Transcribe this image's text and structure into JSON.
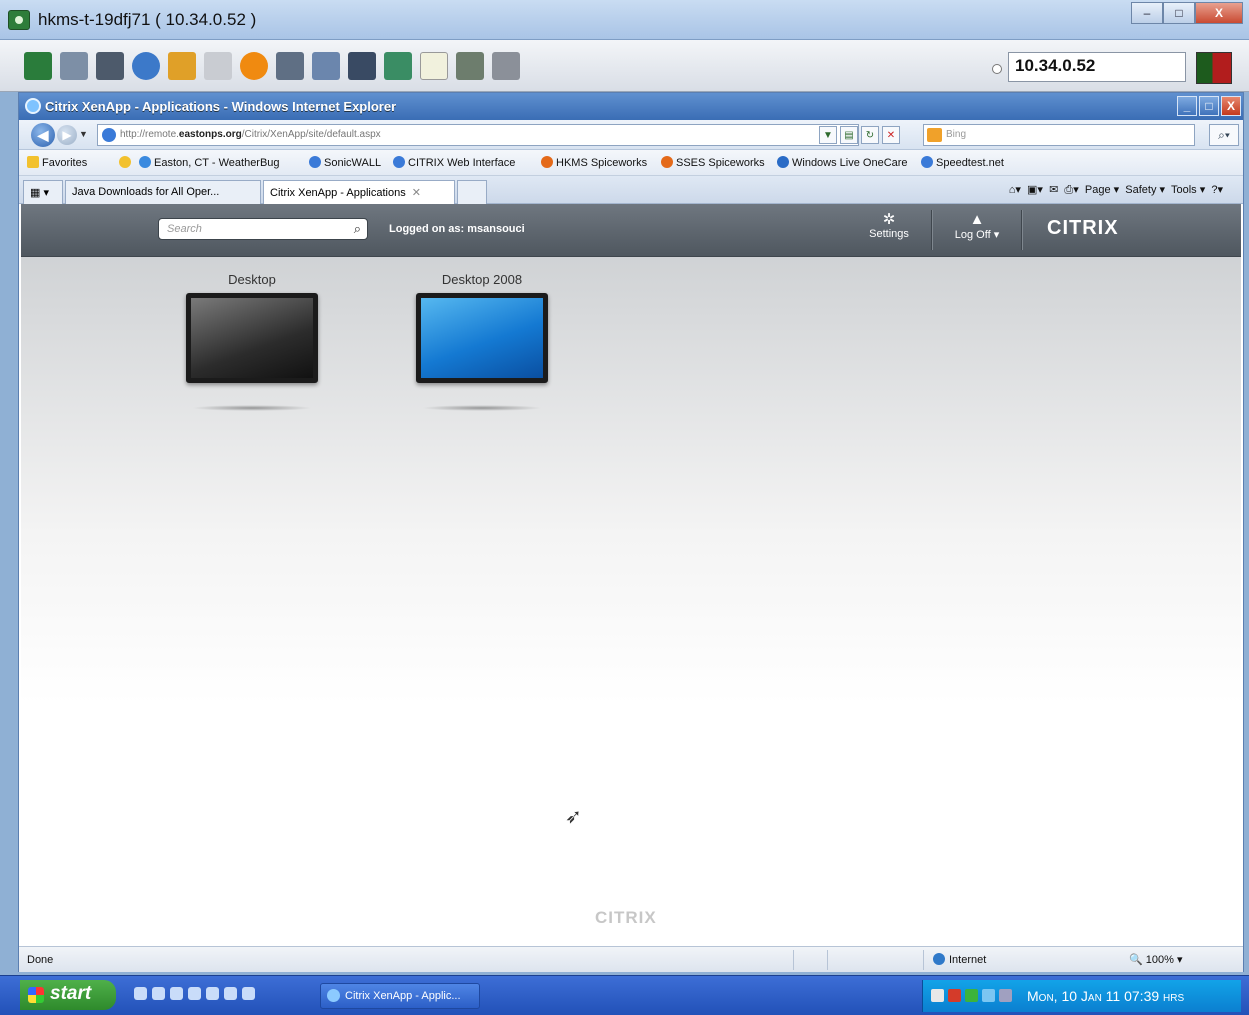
{
  "outer_window": {
    "title": "hkms-t-19dfj71 ( 10.34.0.52 )",
    "controls": {
      "minimize": "–",
      "maximize": "□",
      "close": "X"
    }
  },
  "remote_toolbar": {
    "address": "10.34.0.52",
    "tool_icons": [
      "monitor-icon",
      "tree-icon",
      "tools-icon",
      "refresh-icon",
      "paint-icon",
      "printer-icon",
      "alert-icon",
      "network-icon",
      "fullscreen-icon",
      "display-icon",
      "transfer-icon",
      "file-icon",
      "screenshot-icon",
      "window-icon"
    ],
    "colors": {
      "flag_left": "#1d5b1d",
      "flag_right": "#b21d1d"
    }
  },
  "ie": {
    "title": "Citrix XenApp - Applications - Windows Internet Explorer",
    "controls": {
      "minimize": "_",
      "maximize": "□",
      "close": "X"
    },
    "address_prefix": "http://remote.",
    "address_domain": "eastonps.org",
    "address_path": "/Citrix/XenApp/site/default.aspx",
    "search_placeholder": "Bing",
    "favorites_label": "Favorites",
    "favorites": [
      "Easton, CT - WeatherBug",
      "SonicWALL",
      "CITRIX Web Interface",
      "HKMS Spiceworks",
      "SSES Spiceworks",
      "Windows Live OneCare",
      "Speedtest.net"
    ],
    "tabs": [
      {
        "label": "Java Downloads for All Oper..."
      },
      {
        "label": "Citrix XenApp - Applications",
        "close": "✕"
      }
    ],
    "command_bar": {
      "page": "Page ▾",
      "safety": "Safety ▾",
      "tools": "Tools ▾"
    },
    "status": {
      "text": "Done",
      "zone": "Internet",
      "zoom": "100%"
    }
  },
  "citrix": {
    "search_placeholder": "Search",
    "logged_on": "Logged on as: msansouci",
    "settings_label": "Settings",
    "logoff_label": "Log Off ▾",
    "logo": "CITRIX",
    "footer_logo": "CITRIX",
    "apps": [
      {
        "label": "Desktop",
        "screen": "gray"
      },
      {
        "label": "Desktop 2008",
        "screen": "blue"
      }
    ],
    "colors": {
      "header_bar": "#5d656d",
      "header_text": "#ffffff"
    }
  },
  "taskbar": {
    "start_label": "start",
    "task_button": "Citrix XenApp - Applic...",
    "clock": "Mon, 10 Jan 11 07:39 hrs"
  }
}
